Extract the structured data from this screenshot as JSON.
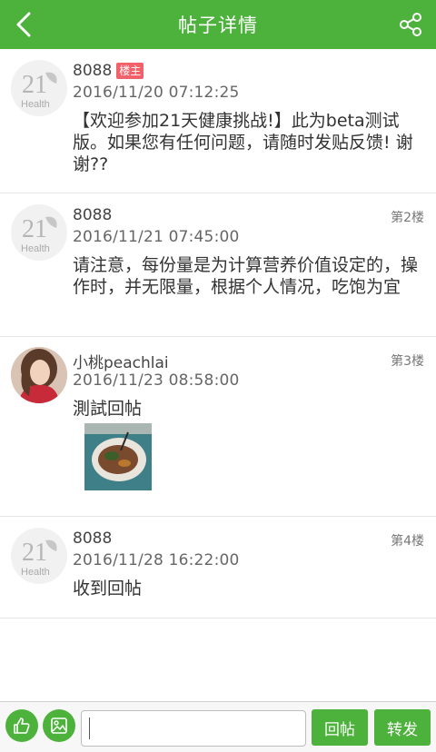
{
  "header": {
    "title": "帖子详情",
    "back_icon": "chevron-left-icon",
    "share_icon": "share-icon"
  },
  "posts": [
    {
      "user": "8088",
      "badge": "楼主",
      "floor": "",
      "time": "2016/11/20 07:12:25",
      "content": "【欢迎参加21天健康挑战!】此为beta测试版。如果您有任何问题，请随时发贴反馈! 谢谢??",
      "avatar_text": "21",
      "avatar_sub": "Health"
    },
    {
      "user": "8088",
      "floor": "第2楼",
      "time": "2016/11/21 07:45:00",
      "content": "请注意，每份量是为计算营养价值设定的，操作时，并无限量，根据个人情况，吃饱为宜",
      "avatar_text": "21",
      "avatar_sub": "Health"
    },
    {
      "user": "小桃peachlai",
      "floor": "第3楼",
      "time": "2016/11/23 08:58:00",
      "content": "測試回帖"
    },
    {
      "user": "8088",
      "floor": "第4楼",
      "time": "2016/11/28 16:22:00",
      "content": "收到回帖",
      "avatar_text": "21",
      "avatar_sub": "Health"
    }
  ],
  "footer": {
    "like_icon": "thumbs-up-icon",
    "image_icon": "image-icon",
    "reply_input_value": "",
    "reply_button": "回帖",
    "forward_button": "转发"
  },
  "colors": {
    "accent": "#4db23c",
    "badge": "#f2606a"
  }
}
